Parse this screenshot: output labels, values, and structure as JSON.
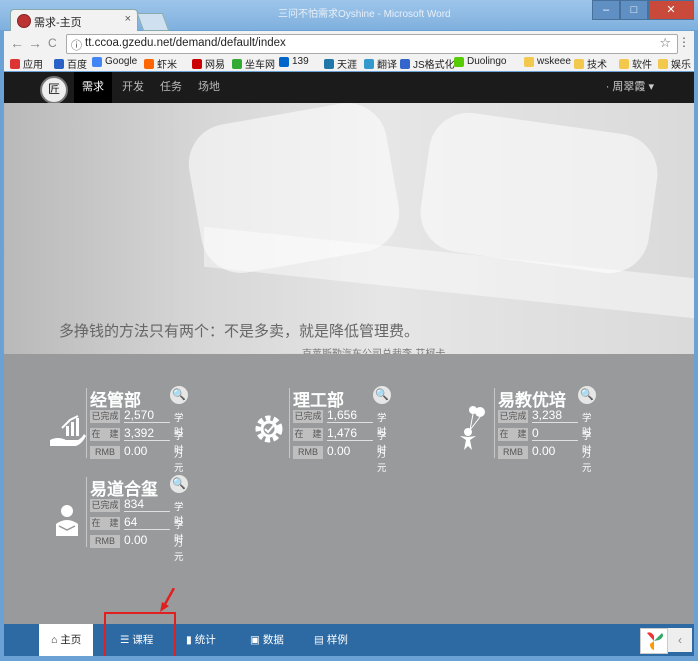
{
  "window": {
    "tab_title": "需求-主页",
    "tab_close": "×",
    "caption": "三问不怕需求Oyshine - Microsoft Word",
    "minimize": "–",
    "maximize": "□",
    "close": "✕"
  },
  "toolbar": {
    "back": "←",
    "forward": "→",
    "reload": "C",
    "url": "tt.ccoa.gzedu.net/demand/default/index",
    "star": "☆",
    "menu": "⋮"
  },
  "bookmarks": [
    {
      "label": "应用",
      "color": "#d33"
    },
    {
      "label": "百度",
      "color": "#2a62c8"
    },
    {
      "label": "Google",
      "color": "#4285f4"
    },
    {
      "label": "虾米",
      "color": "#f60"
    },
    {
      "label": "网易",
      "color": "#c00"
    },
    {
      "label": "坐车网",
      "color": "#3a3"
    },
    {
      "label": "139",
      "color": "#06c"
    },
    {
      "label": "天涯",
      "color": "#2277aa"
    },
    {
      "label": "翻译",
      "color": "#3399cc"
    },
    {
      "label": "JS格式化",
      "color": "#36c"
    },
    {
      "label": "Duolingo",
      "color": "#58cc02"
    },
    {
      "label": "wskeee",
      "color": "#f2c94c"
    },
    {
      "label": "技术",
      "color": "#f2c94c"
    },
    {
      "label": "软件",
      "color": "#f2c94c"
    },
    {
      "label": "娱乐",
      "color": "#f2c94c"
    }
  ],
  "topnav": {
    "logo_text": "匠",
    "items": [
      "需求",
      "开发",
      "任务",
      "场地"
    ],
    "active": "需求",
    "user": "· 周翠霞 ▾"
  },
  "hero": {
    "quote": "多挣钱的方法只有两个：不是多卖，就是降低管理费。",
    "author": "——克莱斯勒汽车公司总裁李·艾柯卡"
  },
  "departments": [
    {
      "name": "经管部",
      "icon": "hand-chart-icon",
      "rows": [
        {
          "label": "已完成",
          "value": "2,570",
          "unit": "学时"
        },
        {
          "label": "在　建",
          "value": "3,392",
          "unit": "学时"
        },
        {
          "label": "RMB",
          "value": "0.00",
          "unit": "万元"
        }
      ]
    },
    {
      "name": "理工部",
      "icon": "gear-icon",
      "rows": [
        {
          "label": "已完成",
          "value": "1,656",
          "unit": "学时"
        },
        {
          "label": "在　建",
          "value": "1,476",
          "unit": "学时"
        },
        {
          "label": "RMB",
          "value": "0.00",
          "unit": "万元"
        }
      ]
    },
    {
      "name": "易教优培",
      "icon": "balloon-person-icon",
      "rows": [
        {
          "label": "已完成",
          "value": "3,238",
          "unit": "学时"
        },
        {
          "label": "在　建",
          "value": "0",
          "unit": "学时"
        },
        {
          "label": "RMB",
          "value": "0.00",
          "unit": "万元"
        }
      ]
    },
    {
      "name": "易道合玺",
      "icon": "reader-icon",
      "rows": [
        {
          "label": "已完成",
          "value": "834",
          "unit": "学时"
        },
        {
          "label": "在　建",
          "value": "64",
          "unit": "学时"
        },
        {
          "label": "RMB",
          "value": "0.00",
          "unit": "万元"
        }
      ]
    }
  ],
  "bottom_nav": [
    {
      "label": "主页",
      "icon": "home-icon",
      "glyph": "⌂"
    },
    {
      "label": "课程",
      "icon": "list-icon",
      "glyph": "☰"
    },
    {
      "label": "统计",
      "icon": "bar-chart-icon",
      "glyph": "▮"
    },
    {
      "label": "数据",
      "icon": "briefcase-icon",
      "glyph": "▣"
    },
    {
      "label": "样例",
      "icon": "window-icon",
      "glyph": "▤"
    }
  ],
  "side": {
    "collapse": "‹"
  },
  "colors": {
    "nav_bg": "#1b1b1b",
    "bottom_bar": "#2d6aa3",
    "highlight": "#e02020",
    "stats_bg": "#999a9b"
  }
}
